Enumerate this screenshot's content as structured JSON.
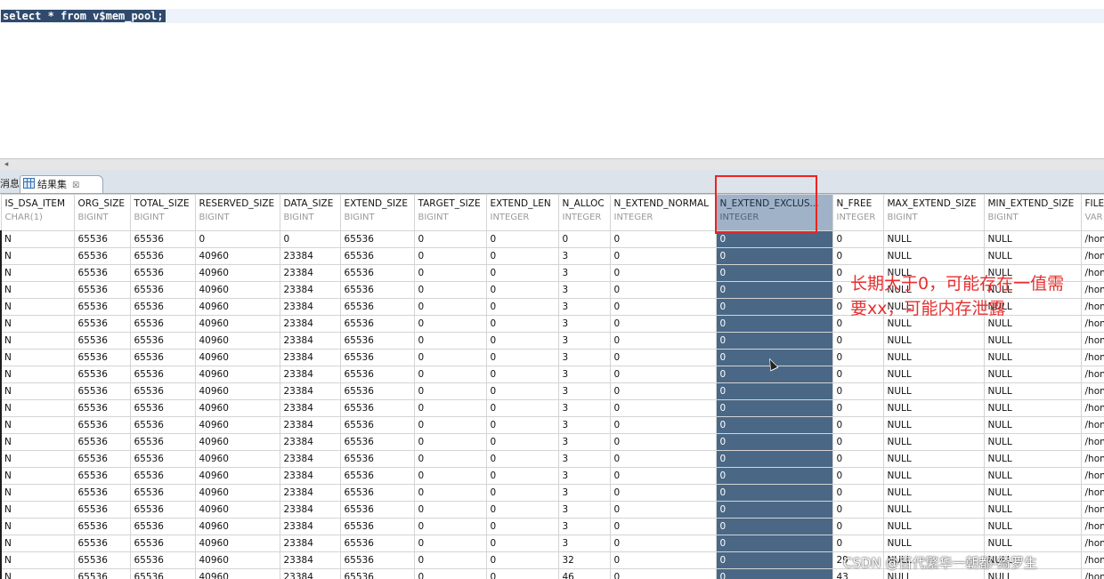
{
  "editor": {
    "sql": "select * from v$mem_pool;"
  },
  "tabs": {
    "messages_label": "消息",
    "result_label": "结果集",
    "result_close": "☒"
  },
  "columns": [
    {
      "name": "IS_DSA_ITEM",
      "type": "CHAR(1)"
    },
    {
      "name": "ORG_SIZE",
      "type": "BIGINT"
    },
    {
      "name": "TOTAL_SIZE",
      "type": "BIGINT"
    },
    {
      "name": "RESERVED_SIZE",
      "type": "BIGINT"
    },
    {
      "name": "DATA_SIZE",
      "type": "BIGINT"
    },
    {
      "name": "EXTEND_SIZE",
      "type": "BIGINT"
    },
    {
      "name": "TARGET_SIZE",
      "type": "BIGINT"
    },
    {
      "name": "EXTEND_LEN",
      "type": "INTEGER"
    },
    {
      "name": "N_ALLOC",
      "type": "INTEGER"
    },
    {
      "name": "N_EXTEND_NORMAL",
      "type": "INTEGER"
    },
    {
      "name": "N_EXTEND_EXCLUS...",
      "type": "INTEGER"
    },
    {
      "name": "N_FREE",
      "type": "INTEGER"
    },
    {
      "name": "MAX_EXTEND_SIZE",
      "type": "BIGINT"
    },
    {
      "name": "MIN_EXTEND_SIZE",
      "type": "BIGINT"
    },
    {
      "name": "FILE",
      "type": "VAR"
    }
  ],
  "selected_column": 10,
  "rows": [
    [
      "N",
      "65536",
      "65536",
      "0",
      "0",
      "65536",
      "0",
      "0",
      "0",
      "0",
      "0",
      "0",
      "NULL",
      "NULL",
      "/hon"
    ],
    [
      "N",
      "65536",
      "65536",
      "40960",
      "23384",
      "65536",
      "0",
      "0",
      "3",
      "0",
      "0",
      "0",
      "NULL",
      "NULL",
      "/hon"
    ],
    [
      "N",
      "65536",
      "65536",
      "40960",
      "23384",
      "65536",
      "0",
      "0",
      "3",
      "0",
      "0",
      "0",
      "NULL",
      "NULL",
      "/hon"
    ],
    [
      "N",
      "65536",
      "65536",
      "40960",
      "23384",
      "65536",
      "0",
      "0",
      "3",
      "0",
      "0",
      "0",
      "NULL",
      "NULL",
      "/hon"
    ],
    [
      "N",
      "65536",
      "65536",
      "40960",
      "23384",
      "65536",
      "0",
      "0",
      "3",
      "0",
      "0",
      "0",
      "NULL",
      "NULL",
      "/hon"
    ],
    [
      "N",
      "65536",
      "65536",
      "40960",
      "23384",
      "65536",
      "0",
      "0",
      "3",
      "0",
      "0",
      "0",
      "NULL",
      "NULL",
      "/hon"
    ],
    [
      "N",
      "65536",
      "65536",
      "40960",
      "23384",
      "65536",
      "0",
      "0",
      "3",
      "0",
      "0",
      "0",
      "NULL",
      "NULL",
      "/hon"
    ],
    [
      "N",
      "65536",
      "65536",
      "40960",
      "23384",
      "65536",
      "0",
      "0",
      "3",
      "0",
      "0",
      "0",
      "NULL",
      "NULL",
      "/hon"
    ],
    [
      "N",
      "65536",
      "65536",
      "40960",
      "23384",
      "65536",
      "0",
      "0",
      "3",
      "0",
      "0",
      "0",
      "NULL",
      "NULL",
      "/hon"
    ],
    [
      "N",
      "65536",
      "65536",
      "40960",
      "23384",
      "65536",
      "0",
      "0",
      "3",
      "0",
      "0",
      "0",
      "NULL",
      "NULL",
      "/hon"
    ],
    [
      "N",
      "65536",
      "65536",
      "40960",
      "23384",
      "65536",
      "0",
      "0",
      "3",
      "0",
      "0",
      "0",
      "NULL",
      "NULL",
      "/hon"
    ],
    [
      "N",
      "65536",
      "65536",
      "40960",
      "23384",
      "65536",
      "0",
      "0",
      "3",
      "0",
      "0",
      "0",
      "NULL",
      "NULL",
      "/hon"
    ],
    [
      "N",
      "65536",
      "65536",
      "40960",
      "23384",
      "65536",
      "0",
      "0",
      "3",
      "0",
      "0",
      "0",
      "NULL",
      "NULL",
      "/hon"
    ],
    [
      "N",
      "65536",
      "65536",
      "40960",
      "23384",
      "65536",
      "0",
      "0",
      "3",
      "0",
      "0",
      "0",
      "NULL",
      "NULL",
      "/hon"
    ],
    [
      "N",
      "65536",
      "65536",
      "40960",
      "23384",
      "65536",
      "0",
      "0",
      "3",
      "0",
      "0",
      "0",
      "NULL",
      "NULL",
      "/hon"
    ],
    [
      "N",
      "65536",
      "65536",
      "40960",
      "23384",
      "65536",
      "0",
      "0",
      "3",
      "0",
      "0",
      "0",
      "NULL",
      "NULL",
      "/hon"
    ],
    [
      "N",
      "65536",
      "65536",
      "40960",
      "23384",
      "65536",
      "0",
      "0",
      "3",
      "0",
      "0",
      "0",
      "NULL",
      "NULL",
      "/hon"
    ],
    [
      "N",
      "65536",
      "65536",
      "40960",
      "23384",
      "65536",
      "0",
      "0",
      "3",
      "0",
      "0",
      "0",
      "NULL",
      "NULL",
      "/hon"
    ],
    [
      "N",
      "65536",
      "65536",
      "40960",
      "23384",
      "65536",
      "0",
      "0",
      "3",
      "0",
      "0",
      "0",
      "NULL",
      "NULL",
      "/hon"
    ],
    [
      "N",
      "65536",
      "65536",
      "40960",
      "23384",
      "65536",
      "0",
      "0",
      "32",
      "0",
      "0",
      "29",
      "NULL",
      "NULL",
      "/hon"
    ],
    [
      "N",
      "65536",
      "65536",
      "40960",
      "23384",
      "65536",
      "0",
      "0",
      "46",
      "0",
      "0",
      "43",
      "NULL",
      "NULL",
      "/hon"
    ]
  ],
  "annotation": {
    "line1": "长期大于0，可能存在一值需",
    "line2": "要xx，可能内存泄露"
  },
  "watermark": "CSDN @百代繁华一朝都-绮罗生",
  "colors": {
    "selection": "#4a6886",
    "highlight": "#ee2222",
    "annotation": "#e53030"
  }
}
